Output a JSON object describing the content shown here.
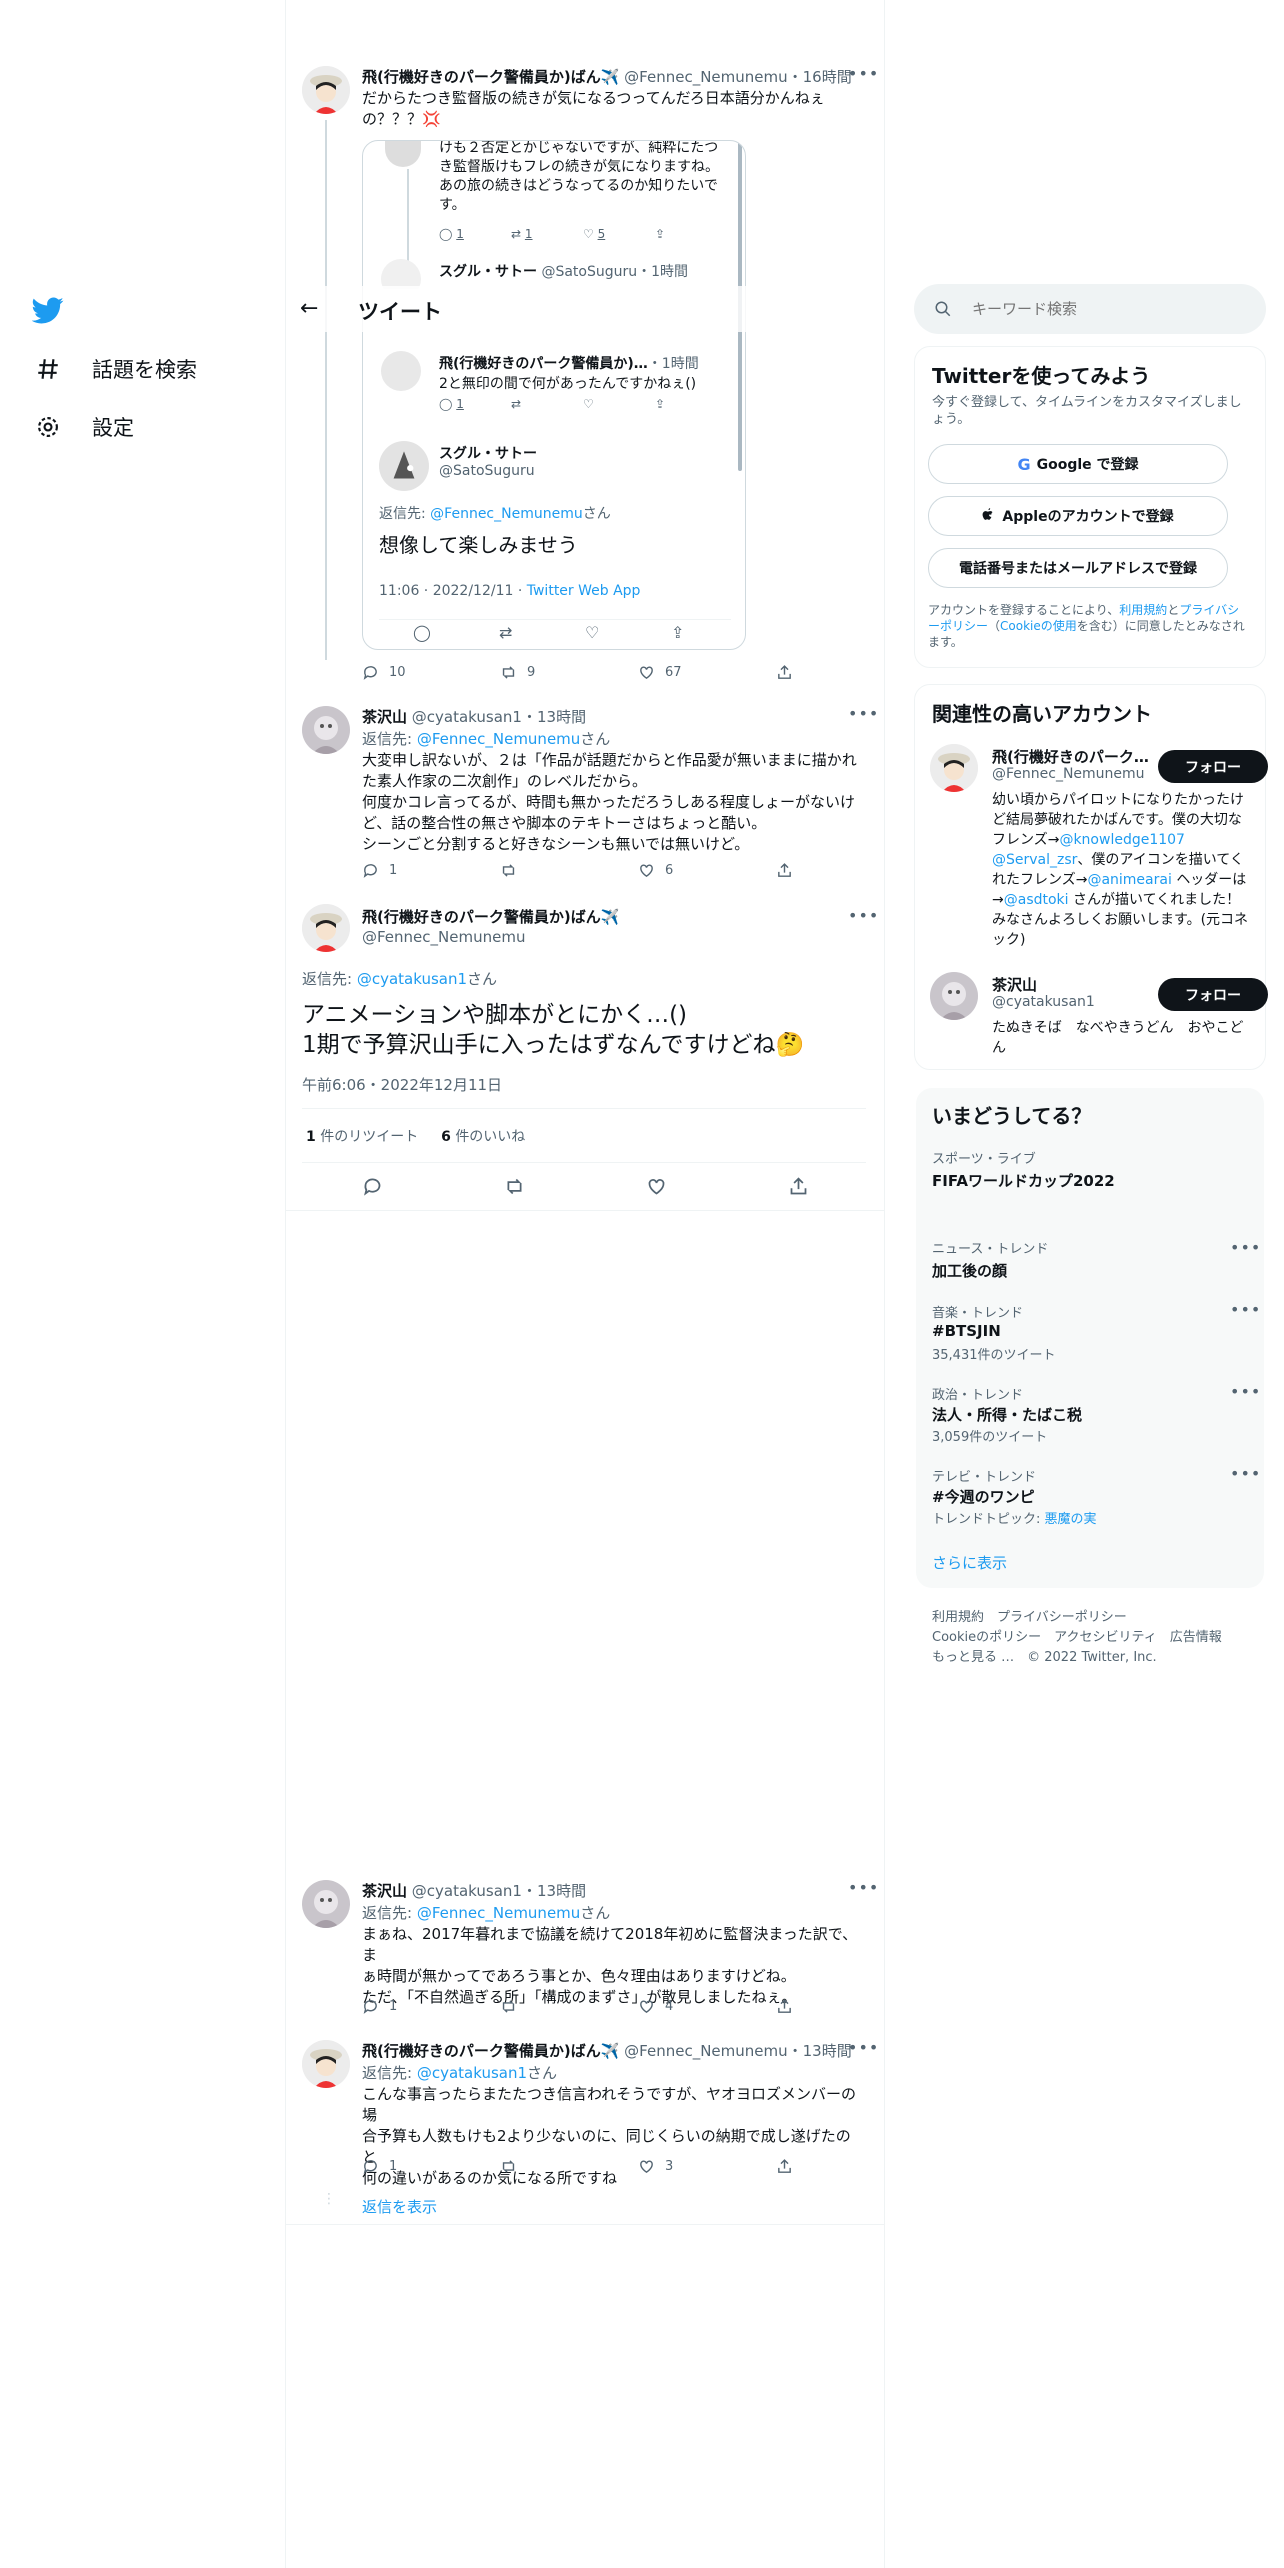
{
  "nav": {
    "explore_label": "話題を検索",
    "settings_label": "設定"
  },
  "header": {
    "title": "ツイート"
  },
  "search": {
    "placeholder": "キーワード検索"
  },
  "tweet1": {
    "name": "飛(行機好きのパーク警備員か)ばん✈️",
    "handle": "@Fennec_Nemunemu",
    "time": "・16時間",
    "text": "だからたつき監督版の続きが気になるつってんだろ日本語分かんねぇの？？？💢",
    "replies": "10",
    "retweets": "9",
    "likes": "67"
  },
  "screenshot": {
    "top_text": "けも２否定とかじゃないですが、純粋にたつき監督版けもフレの続きが気になりますね。あの旅の続きはどうなってるのか知りたいです。",
    "top_replies": "1",
    "top_retweets": "1",
    "top_likes": "5",
    "row2_name": "スグル・サトー",
    "row2_handle": "@SatoSuguru",
    "row2_time": "・1時間",
    "row3_name": "飛(行機好きのパーク警備員か)…",
    "row3_time": "・1時間",
    "row3_text": "2と無印の間で何があったんですかねぇ()",
    "row3_replies": "1",
    "main_name": "スグル・サトー",
    "main_handle": "@SatoSuguru",
    "reply_prefix": "返信先:",
    "reply_to": "@Fennec_Nemunemu",
    "reply_suffix": "さん",
    "main_text": "想像して楽しみませう",
    "stamp_time": "11:06 · 2022/12/11 · ",
    "stamp_app": "Twitter Web App"
  },
  "tweet2": {
    "name": "茶沢山",
    "handle": "@cyatakusan1",
    "time": "・13時間",
    "reply_prefix": "返信先:",
    "reply_to": "@Fennec_Nemunemu",
    "reply_suffix": "さん",
    "lines": [
      "大変申し訳ないが、２は「作品が話題だからと作品愛が無いままに描かれ",
      "た素人作家の二次創作」のレベルだから。",
      "何度かコレ言ってるが、時間も無かっただろうしある程度しょーがないけ",
      "ど、話の整合性の無さや脚本のテキトーさはちょっと酷い。",
      "シーンごと分割すると好きなシーンも無いでは無いけど。"
    ],
    "replies": "1",
    "likes": "6"
  },
  "main_tweet": {
    "name": "飛(行機好きのパーク警備員か)ばん✈️",
    "handle": "@Fennec_Nemunemu",
    "reply_prefix": "返信先:",
    "reply_to": "@cyatakusan1",
    "reply_suffix": "さん",
    "line1": "アニメーションや脚本がとにかく…()",
    "line2": "1期で予算沢山手に入ったはずなんですけどね🤔",
    "timestamp": "午前6:06・2022年12月11日",
    "retweet_count": "1",
    "retweet_label": "件のリツイート",
    "like_count": "6",
    "like_label": "件のいいね"
  },
  "tweet3": {
    "name": "茶沢山",
    "handle": "@cyatakusan1",
    "time": "・13時間",
    "reply_prefix": "返信先:",
    "reply_to": "@Fennec_Nemunemu",
    "reply_suffix": "さん",
    "lines": [
      "まぁね、2017年暮れまで協議を続けて2018年初めに監督決まった訳で、ま",
      "ぁ時間が無かってであろう事とか、色々理由はありますけどね。",
      "ただ、「不自然過ぎる所」「構成のまずさ」が散見しましたねぇ。"
    ],
    "replies": "1",
    "likes": "4"
  },
  "tweet4": {
    "name": "飛(行機好きのパーク警備員か)ばん✈️",
    "handle": "@Fennec_Nemunemu",
    "time": "・13時間",
    "reply_prefix": "返信先:",
    "reply_to": "@cyatakusan1",
    "reply_suffix": "さん",
    "lines": [
      "こんな事言ったらまたたつき信言われそうですが、ヤオヨロズメンバーの場",
      "合予算も人数もけも2より少ないのに、同じくらいの納期で成し遂げたのと",
      "何の違いがあるのか気になる所ですね"
    ],
    "replies": "1",
    "likes": "3",
    "show_replies": "返信を表示"
  },
  "signup": {
    "title": "Twitterを使ってみよう",
    "subtitle": "今すぐ登録して、タイムラインをカスタマイズしましょう。",
    "google": "Google で登録",
    "apple": "Appleのアカウントで登録",
    "phone": "電話番号またはメールアドレスで登録",
    "legal_1": "アカウントを登録することにより、",
    "legal_terms": "利用規約",
    "legal_2": "と",
    "legal_privacy": "プライバシーポリシー",
    "legal_3": "（",
    "legal_cookie": "Cookieの使用",
    "legal_4": "を含む）に同意したとみなされます。"
  },
  "related": {
    "title": "関連性の高いアカウント",
    "acc1_name": "飛(行機好きのパーク…",
    "acc1_handle": "@Fennec_Nemunemu",
    "follow": "フォロー",
    "acc1_bio_lines": [
      [
        "幼い頃からパイロットになりたかったけど結局夢破れたかばんです。僕の大",
        ""
      ],
      [
        "切なフレンズ→",
        "@knowledge1107"
      ],
      [
        "@Serval_zsr",
        "、僕のアイコンを描いて"
      ],
      [
        "くれたフレンズ→",
        "@animearai"
      ],
      [
        "ヘッダーは→",
        "@asdtoki"
      ]
    ],
    "acc1_bio_end": "さんが描いてくれました！みなさんよろしくお願いします。(元コネック)",
    "acc2_name": "茶沢山",
    "acc2_handle": "@cyatakusan1",
    "acc2_bio": "たぬきそば　なべやきうどん　おやこどん"
  },
  "trends": {
    "title": "いまどうしてる？",
    "items": [
      {
        "category": "スポーツ・ライブ",
        "name": "FIFAワールドカップ2022",
        "count": ""
      },
      {
        "category": "ニュース・トレンド",
        "name": "加工後の顔",
        "count": ""
      },
      {
        "category": "音楽・トレンド",
        "name": "#BTSJIN",
        "count": "35,431件のツイート"
      },
      {
        "category": "政治・トレンド",
        "name": "法人・所得・たばこ税",
        "count": "3,059件のツイート"
      },
      {
        "category": "テレビ・トレンド",
        "name": "#今週のワンピ",
        "count": "トレンドトピック: ",
        "count_link": "悪魔の実"
      }
    ],
    "show_more": "さらに表示"
  },
  "footer": {
    "line1": "利用規約　プライバシーポリシー",
    "line2": "Cookieのポリシー　アクセシビリティ　広告情報",
    "line3": "もっと見る …　© 2022 Twitter, Inc."
  },
  "colors": {
    "accent": "#1d9bf0",
    "text": "#0f1419",
    "muted": "#536471",
    "border": "#eff3f4"
  }
}
